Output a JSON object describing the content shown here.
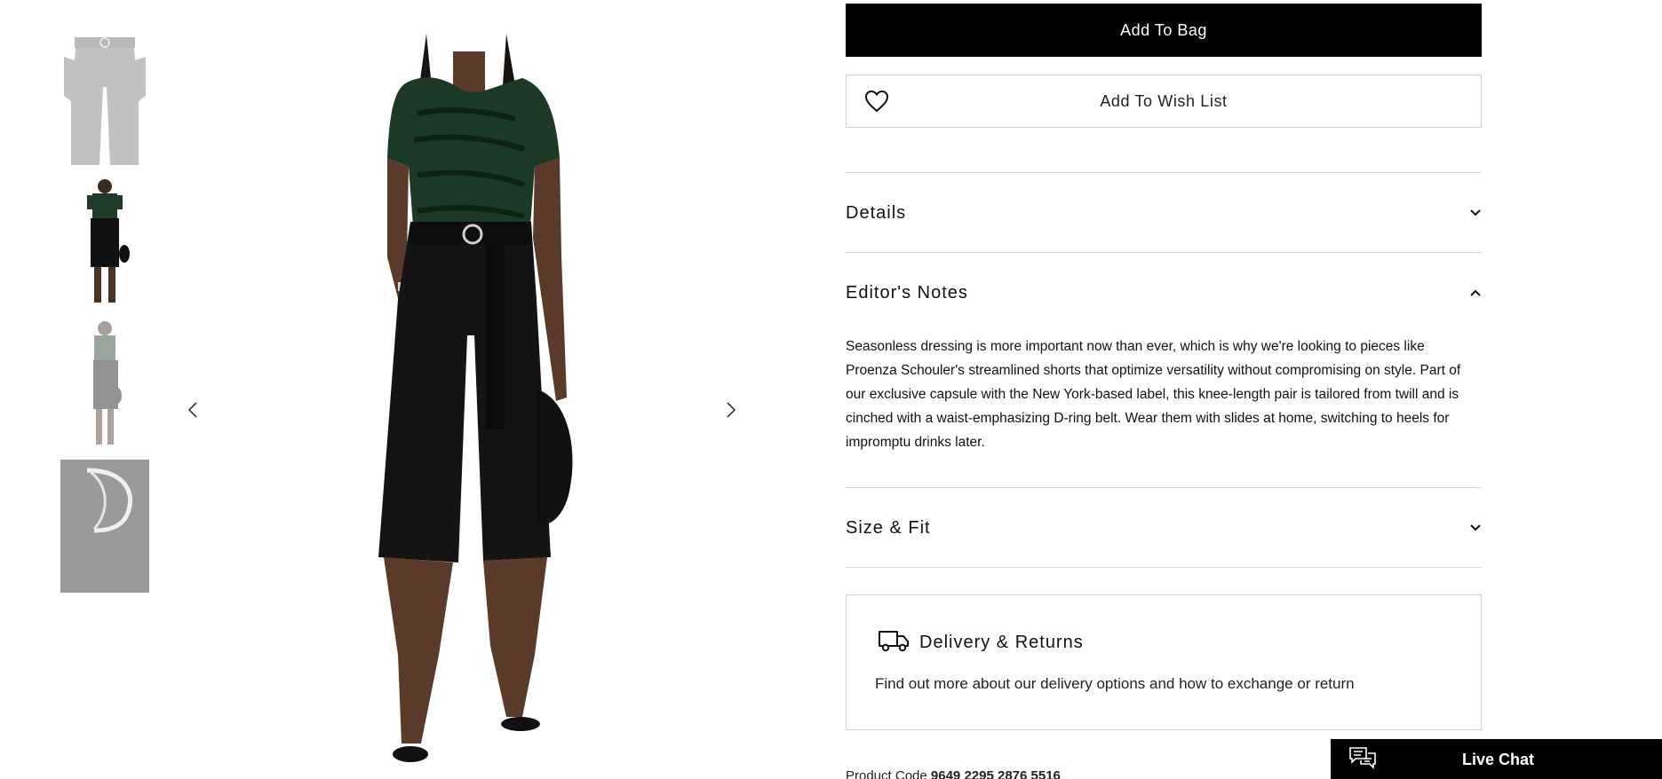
{
  "gallery": {
    "thumbnails": [
      {
        "alt": "shorts-flat-front"
      },
      {
        "alt": "model-front"
      },
      {
        "alt": "model-side"
      },
      {
        "alt": "d-ring-detail"
      }
    ],
    "prev_icon": "chevron-left-icon",
    "next_icon": "chevron-right-icon"
  },
  "actions": {
    "add_to_bag": "Add To Bag",
    "add_to_wishlist": "Add To Wish List"
  },
  "accordion": {
    "details": {
      "title": "Details",
      "expanded": false
    },
    "editors_notes": {
      "title": "Editor's Notes",
      "expanded": true,
      "body": "Seasonless dressing is more important now than ever, which is why we're looking to pieces like Proenza Schouler's streamlined shorts that optimize versatility without compromising on style. Part of our exclusive capsule with the New York-based label, this knee-length pair is tailored from twill and is cinched with a waist-emphasizing D-ring belt. Wear them with slides at home, switching to heels for impromptu drinks later."
    },
    "size_fit": {
      "title": "Size & Fit",
      "expanded": false
    }
  },
  "delivery": {
    "title": "Delivery & Returns",
    "text": "Find out more about our delivery options and how to exchange or return"
  },
  "product_code": {
    "label": "Product Code",
    "value": "9649 2295 2876 5516"
  },
  "live_chat": {
    "label": "Live Chat"
  },
  "colors": {
    "button_primary": "#000000",
    "divider": "#d8d8d8",
    "thumb_gray": "#9a9a9a"
  }
}
